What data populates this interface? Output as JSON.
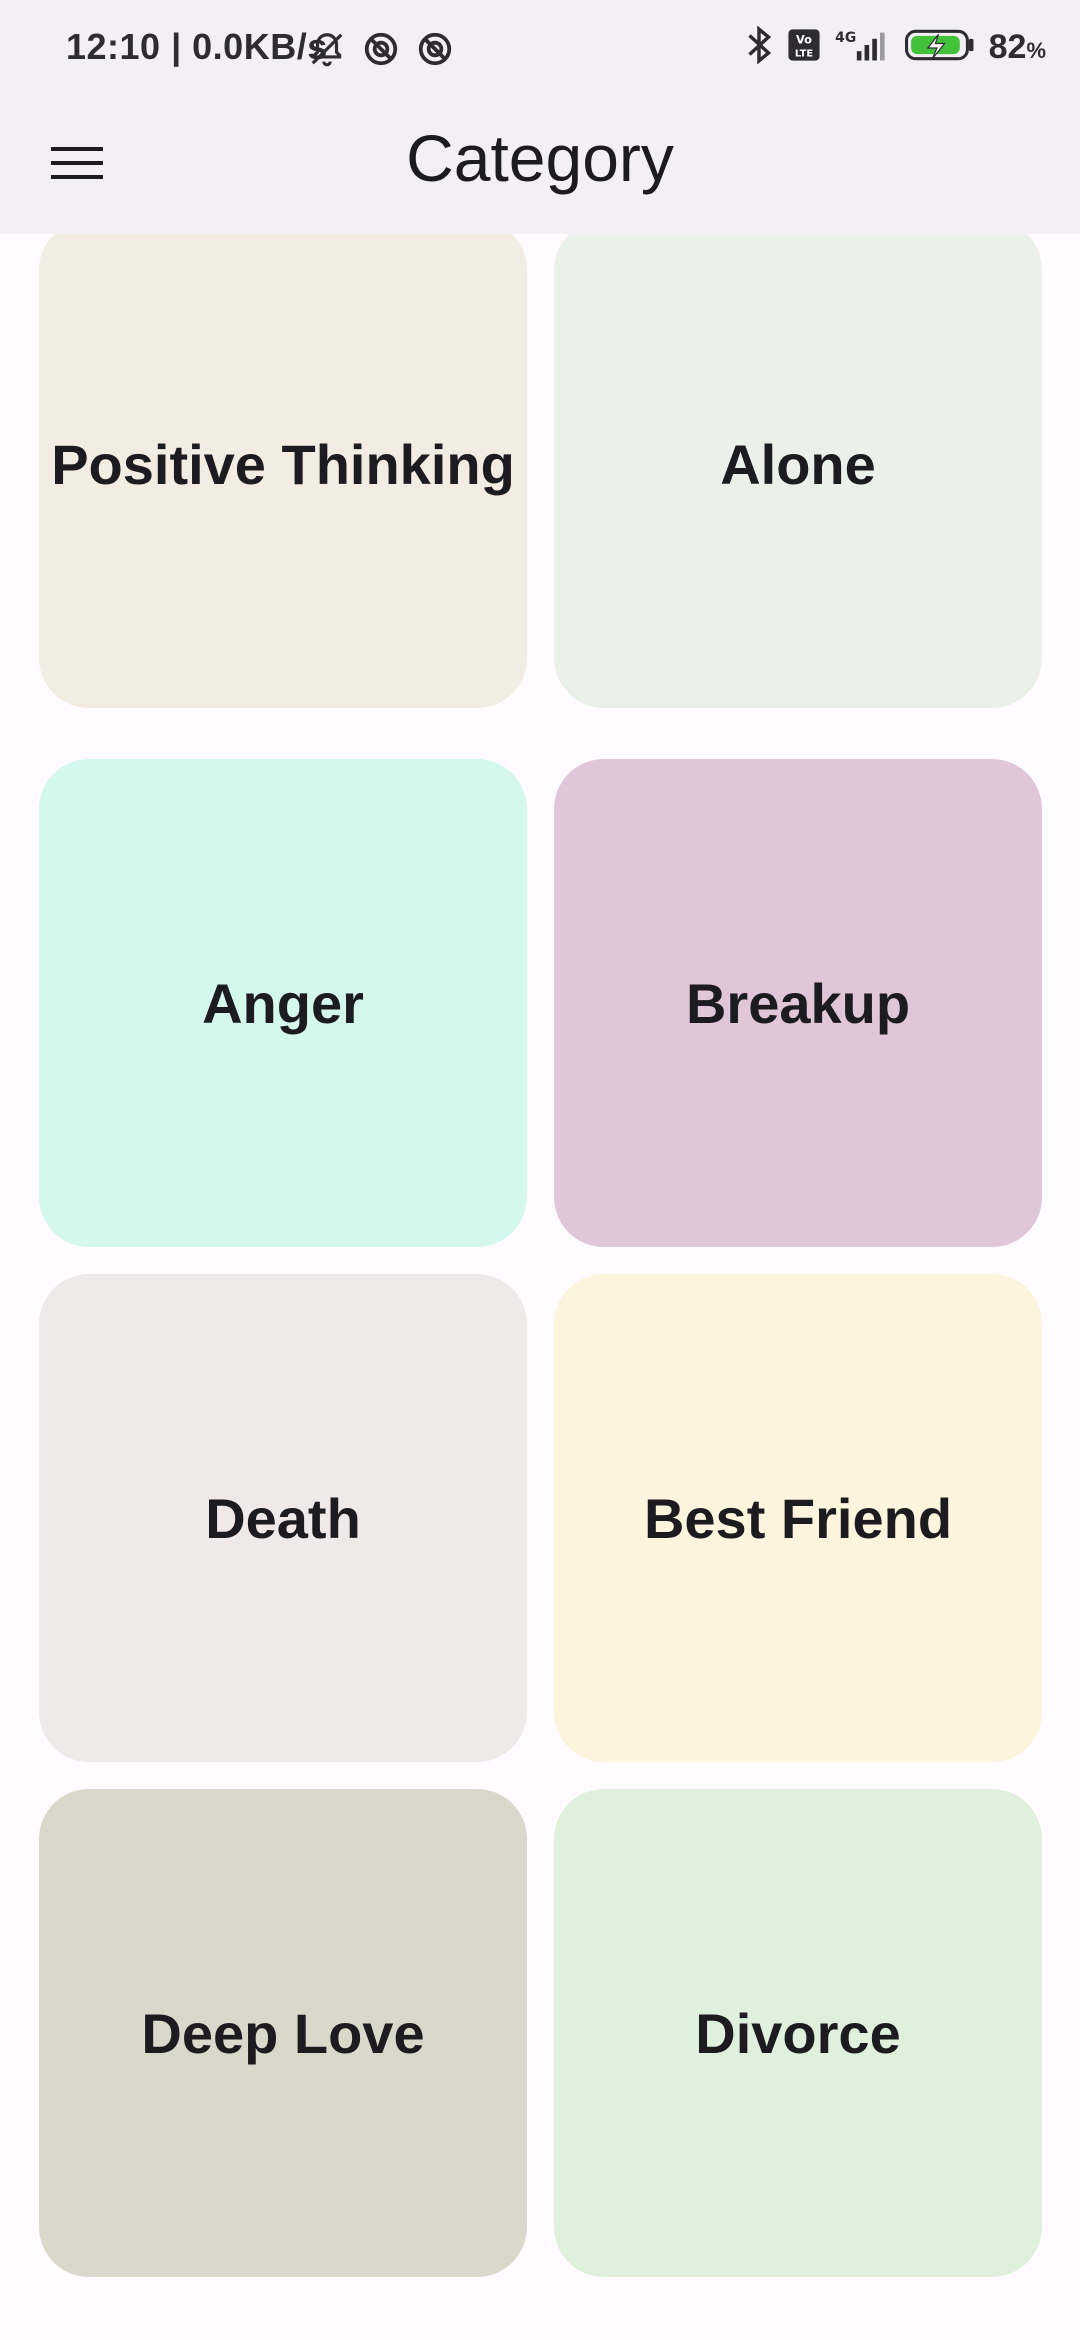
{
  "status_bar": {
    "time": "12:10",
    "speed": "0.0KB/s",
    "battery_percent": "82",
    "battery_unit": "%",
    "icons": [
      "muted-bell-icon",
      "sync-icon",
      "sync-icon",
      "bluetooth-icon",
      "volte-icon",
      "signal-4g-icon",
      "battery-charging-icon"
    ]
  },
  "app_bar": {
    "title": "Category",
    "menu_icon": "hamburger-menu-icon"
  },
  "categories": [
    {
      "label": "Positive Thinking",
      "color": "#f3ece2"
    },
    {
      "label": "Alone",
      "color": "#ebf1ea"
    },
    {
      "label": "Anger",
      "color": "#d5f8ec"
    },
    {
      "label": "Breakup",
      "color": "#dfc7d9"
    },
    {
      "label": "Death",
      "color": "#f0e9e9"
    },
    {
      "label": "Best Friend",
      "color": "#fdf4dd"
    },
    {
      "label": "Deep Love",
      "color": "#d9d9cb"
    },
    {
      "label": "Divorce",
      "color": "#dff1dd"
    }
  ]
}
